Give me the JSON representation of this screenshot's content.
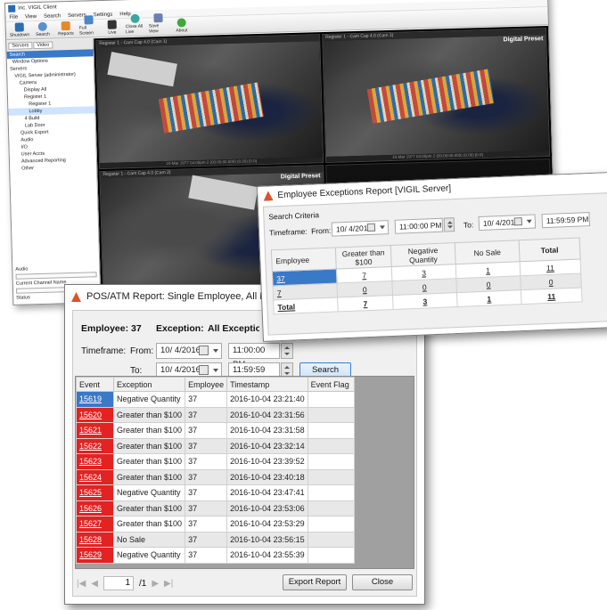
{
  "main_window": {
    "title": "Inc. VIGIL Client",
    "menu": [
      "File",
      "View",
      "Search",
      "Servers",
      "Settings",
      "Help"
    ],
    "toolbar": [
      "Shutdown",
      "Search",
      "Reports",
      "Full Screen",
      "Live",
      "Close All Live",
      "Save View",
      "About"
    ],
    "sidebar": {
      "tabs": [
        "Servers",
        "Video"
      ],
      "header": "Search",
      "tree": [
        "Window Options",
        "Servers",
        "VIGIL Server (administrator)",
        "Camera",
        "Display All",
        "Register 1",
        "Register 1",
        "Lobby",
        "4 Build",
        "Lab Door",
        "Quick Export",
        "Audio",
        "I/O",
        "User Accts",
        "Advanced Reporting",
        "Other"
      ],
      "bottom_labels": [
        "Audio",
        "Current Channel Name",
        "Status"
      ]
    },
    "cameras": [
      {
        "header": "Register 1 - Cam Cap 4.0 (Cam 1)",
        "preset": "",
        "footer": "10-Mar 1977 04:00pm 2 (00:00:00.000) (0.00) [0.0]",
        "has_video": true
      },
      {
        "header": "Register 1 - Cam Cap 4.0 (Cam 3)",
        "preset": "Digital Preset",
        "footer": "10-Mar 1977 04:00pm 2 (00:00:00.000) (0.00) [0.0]",
        "has_video": true
      },
      {
        "header": "Register 1 - Cam Cap 4.0 (Cam 2)",
        "preset": "Digital Preset",
        "footer": "",
        "has_video": true
      },
      {
        "header": "",
        "preset": "",
        "footer": "",
        "has_video": false
      }
    ]
  },
  "pos_dialog": {
    "title": "POS/ATM Report: Single Employee, All Excep",
    "employee_label": "Employee:",
    "employee_value": "37",
    "exception_label": "Exception:",
    "exception_value": "All Exception",
    "timeframe_label": "Timeframe:",
    "from_label": "From:",
    "to_label": "To:",
    "from_date": "10/  4/2016",
    "from_time": "11:00:00 PM",
    "to_date": "10/  4/2016",
    "to_time": "11:59:59 PM",
    "search_button": "Search",
    "columns": [
      "Event",
      "Exception",
      "Employee",
      "Timestamp",
      "Event Flag"
    ],
    "rows": [
      {
        "event": "15619",
        "exception": "Negative Quantity",
        "employee": "37",
        "timestamp": "2016-10-04 23:21:40",
        "flag": ""
      },
      {
        "event": "15620",
        "exception": "Greater than $100",
        "employee": "37",
        "timestamp": "2016-10-04 23:31:56",
        "flag": ""
      },
      {
        "event": "15621",
        "exception": "Greater than $100",
        "employee": "37",
        "timestamp": "2016-10-04 23:31:58",
        "flag": ""
      },
      {
        "event": "15622",
        "exception": "Greater than $100",
        "employee": "37",
        "timestamp": "2016-10-04 23:32:14",
        "flag": ""
      },
      {
        "event": "15623",
        "exception": "Greater than $100",
        "employee": "37",
        "timestamp": "2016-10-04 23:39:52",
        "flag": ""
      },
      {
        "event": "15624",
        "exception": "Greater than $100",
        "employee": "37",
        "timestamp": "2016-10-04 23:40:18",
        "flag": ""
      },
      {
        "event": "15625",
        "exception": "Negative Quantity",
        "employee": "37",
        "timestamp": "2016-10-04 23:47:41",
        "flag": ""
      },
      {
        "event": "15626",
        "exception": "Greater than $100",
        "employee": "37",
        "timestamp": "2016-10-04 23:53:06",
        "flag": ""
      },
      {
        "event": "15627",
        "exception": "Greater than $100",
        "employee": "37",
        "timestamp": "2016-10-04 23:53:29",
        "flag": ""
      },
      {
        "event": "15628",
        "exception": "No Sale",
        "employee": "37",
        "timestamp": "2016-10-04 23:56:15",
        "flag": ""
      },
      {
        "event": "15629",
        "exception": "Negative Quantity",
        "employee": "37",
        "timestamp": "2016-10-04 23:55:39",
        "flag": ""
      }
    ],
    "page_current": "1",
    "page_total": "/1",
    "export_button": "Export Report",
    "close_button": "Close"
  },
  "emp_dialog": {
    "title": "Employee Exceptions Report [VIGIL Server]",
    "search_criteria": "Search Criteria",
    "timeframe_label": "Timeframe:",
    "from_label": "From:",
    "to_label": "To:",
    "from_date": "10/  4/2016",
    "from_time": "11:00:00 PM",
    "to_date": "10/  4/2016",
    "to_time": "11:59:59 PM",
    "columns": [
      "Employee",
      "Greater than $100",
      "Negative Quantity",
      "No Sale",
      "Total"
    ],
    "rows": [
      {
        "employee": "37",
        "gt100": "7",
        "neg": "3",
        "nosale": "1",
        "total": "11"
      },
      {
        "employee": "7",
        "gt100": "0",
        "neg": "0",
        "nosale": "0",
        "total": "0"
      },
      {
        "employee": "Total",
        "gt100": "7",
        "neg": "3",
        "nosale": "1",
        "total": "11"
      }
    ]
  },
  "colors": {
    "event_red": "#e32222",
    "selection_blue": "#3a78c8",
    "title_icon": "#d9532b"
  }
}
